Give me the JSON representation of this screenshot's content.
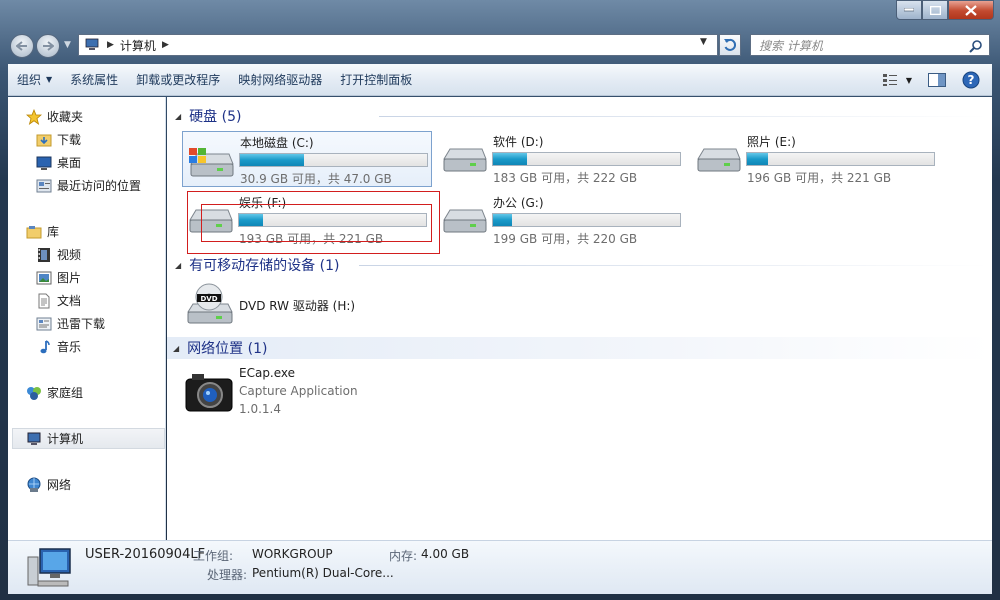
{
  "window": {
    "title_buttons": {
      "minimize": "—",
      "maximize": "□",
      "close": "✕"
    }
  },
  "address": {
    "crumb": "计算机",
    "search_placeholder": "搜索 计算机"
  },
  "toolbar": {
    "organize": "组织",
    "sys_props": "系统属性",
    "uninstall": "卸载或更改程序",
    "map_drive": "映射网络驱动器",
    "control_panel": "打开控制面板"
  },
  "nav": {
    "favorites": "收藏夹",
    "downloads": "下载",
    "desktop": "桌面",
    "recent": "最近访问的位置",
    "libraries": "库",
    "videos": "视频",
    "pictures": "图片",
    "documents": "文档",
    "thunder": "迅雷下载",
    "music": "音乐",
    "homegroup": "家庭组",
    "computer": "计算机",
    "network": "网络"
  },
  "groups": {
    "hdd": "硬盘 (5)",
    "removable": "有可移动存储的设备 (1)",
    "network": "网络位置 (1)"
  },
  "drives": [
    {
      "name": "本地磁盘 (C:)",
      "size_text": "30.9 GB 可用，共 47.0 GB",
      "used_fraction": 0.34
    },
    {
      "name": "软件 (D:)",
      "size_text": "183 GB 可用，共 222 GB",
      "used_fraction": 0.18
    },
    {
      "name": "照片 (E:)",
      "size_text": "196 GB 可用，共 221 GB",
      "used_fraction": 0.11
    },
    {
      "name": "娱乐 (F:)",
      "size_text": "193 GB 可用，共 221 GB",
      "used_fraction": 0.13
    },
    {
      "name": "办公 (G:)",
      "size_text": "199 GB 可用，共 220 GB",
      "used_fraction": 0.1
    }
  ],
  "dvd": {
    "name": "DVD RW 驱动器 (H:)",
    "badge": "DVD"
  },
  "network_item": {
    "name": "ECap.exe",
    "desc": "Capture Application",
    "version": "1.0.1.4"
  },
  "details": {
    "computer_name": "USER-20160904LF",
    "workgroup_label": "工作组:",
    "workgroup": "WORKGROUP",
    "memory_label": "内存:",
    "memory": "4.00 GB",
    "processor_label": "处理器:",
    "processor": "Pentium(R) Dual-Core..."
  },
  "colors": {
    "accent": "#1e3287",
    "bar_fill": "#1a9ac9",
    "highlight_box": "#d21e1e"
  }
}
